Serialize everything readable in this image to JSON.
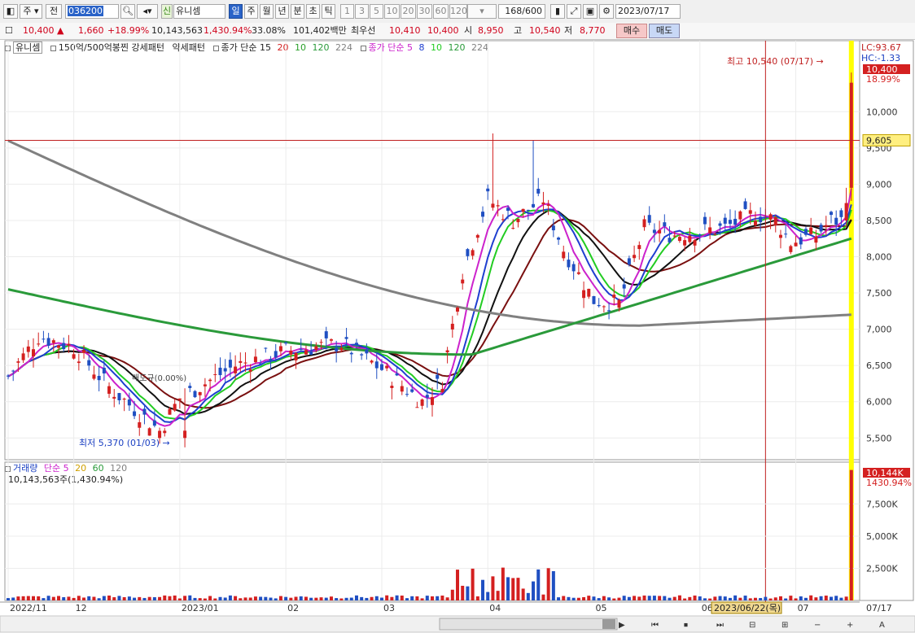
{
  "toolbar": {
    "period": "주",
    "prev_label": "전",
    "code": "036200",
    "tag": "신",
    "stock_name": "유니셈",
    "tabs": [
      "일",
      "주",
      "월",
      "년",
      "분",
      "초",
      "틱"
    ],
    "active_tab": "일",
    "counts": [
      "1",
      "3",
      "5",
      "10",
      "20",
      "30",
      "60",
      "120"
    ],
    "bars_shown": "168",
    "bars_total": "/600",
    "date": "2023/07/17"
  },
  "quote": {
    "price": "10,400",
    "change_arrow": "▲",
    "change": "1,660",
    "change_pct": "+18.99%",
    "volume": "10,143,563",
    "volume_ratio": "1,430.94%",
    "turnover": "33.08%",
    "amount": "101,402백만",
    "best_label": "최우선",
    "ask": "10,410",
    "bid": "10,400",
    "open_label": "시",
    "open": "8,950",
    "high_label": "고",
    "high": "10,540",
    "low_label": "저",
    "low": "8,770",
    "buy_label": "매수",
    "sell_label": "매도"
  },
  "price_legend": {
    "name": "유니셈",
    "pattern1": "150억/500억봉찐 강세패턴",
    "pattern2": "약세패턴",
    "ma_label": "종가 단순 15",
    "ma_periods": [
      "20",
      "10",
      "120",
      "224"
    ],
    "ma2_label": "종가 단순 5",
    "ma2_periods": [
      "8",
      "10",
      "120",
      "224"
    ]
  },
  "volume_legend": {
    "label": "거래량",
    "ma_label": "단순 5",
    "periods": [
      "20",
      "60",
      "120"
    ],
    "value": "10,143,563주(1,430.94%)"
  },
  "annotations": {
    "high_marker": "최고 10,540 (07/17)",
    "low_marker": "최저 5,370 (01/03)",
    "center_note": "매도규(0.00%)",
    "lc": "LC:93.67",
    "hc": "HC:-1.33",
    "last_price": "10,400",
    "last_pct": "18.99%",
    "hline_price": "9,605",
    "last_volume": "10,144K",
    "last_volume_pct": "1430.94%",
    "cursor_date": "2023/06/22(목)",
    "end_date": "07/17"
  },
  "colors": {
    "up": "#d42020",
    "down": "#1f4fc2",
    "ma5": "#cc22cc",
    "ma8": "#1f3fd0",
    "ma10": "#22cc22",
    "ma15": "#111111",
    "ma20": "#7a1010",
    "ma120": "#2a9a3a",
    "ma224": "#808080",
    "highlight": "#ffff00"
  },
  "chart_data": {
    "type": "candlestick",
    "y_axis": {
      "ylim": [
        5200,
        10800
      ],
      "ticks": [
        5500,
        6000,
        6500,
        7000,
        7500,
        8000,
        8500,
        9000,
        9500,
        10000
      ]
    },
    "x_tick_labels": [
      "2022/11",
      "12",
      "2023/01",
      "02",
      "03",
      "04",
      "05",
      "06",
      "07"
    ],
    "key_points": [
      {
        "date": "2022/11",
        "close": 6350
      },
      {
        "date": "2022/12",
        "close": 6800
      },
      {
        "date": "2023/01/03",
        "low": 5370
      },
      {
        "date": "2023/02",
        "close": 6500
      },
      {
        "date": "2023/03",
        "close": 6700
      },
      {
        "date": "2023/03 late",
        "close": 6000
      },
      {
        "date": "2023/04 early",
        "high": 9700
      },
      {
        "date": "2023/04",
        "close": 8700
      },
      {
        "date": "2023/05",
        "close": 7300
      },
      {
        "date": "2023/06",
        "close": 8400
      },
      {
        "date": "2023/07",
        "close": 8300
      },
      {
        "date": "2023/07/17",
        "open": 8950,
        "high": 10540,
        "low": 8770,
        "close": 10400
      }
    ],
    "moving_averages": [
      {
        "name": "120",
        "values_start_end": [
          7500,
          7700
        ]
      },
      {
        "name": "224",
        "values_start_end": [
          9600,
          7200
        ]
      }
    ],
    "volume": {
      "ylim": [
        0,
        10500000
      ],
      "ticks": [
        2500000,
        5000000,
        7500000
      ],
      "tick_labels": [
        "2,500K",
        "5,000K",
        "7,500K"
      ],
      "last": 10143563
    }
  }
}
